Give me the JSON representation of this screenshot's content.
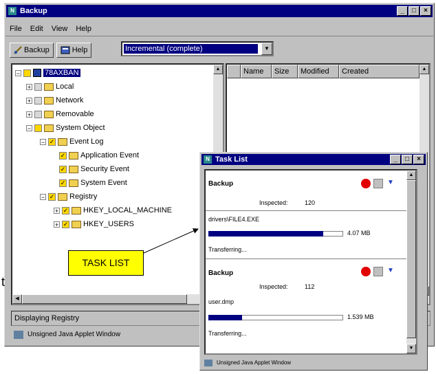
{
  "main_window": {
    "title": "Backup",
    "menu": [
      "File",
      "Edit",
      "View",
      "Help"
    ],
    "toolbar": {
      "backup_label": "Backup",
      "help_label": "Help",
      "mode_value": "Incremental (complete)"
    },
    "tree": [
      {
        "label": "78AXBAN",
        "selected": true
      },
      {
        "label": "Local"
      },
      {
        "label": "Network"
      },
      {
        "label": "Removable"
      },
      {
        "label": "System Object"
      },
      {
        "label": "Event Log"
      },
      {
        "label": "Application Event"
      },
      {
        "label": "Security Event"
      },
      {
        "label": "System Event"
      },
      {
        "label": "Registry"
      },
      {
        "label": "HKEY_LOCAL_MACHINE"
      },
      {
        "label": "HKEY_USERS"
      }
    ],
    "columns": [
      "Name",
      "Size",
      "Modified",
      "Created"
    ],
    "status": "Displaying Registry",
    "applet_notice": "Unsigned Java Applet Window"
  },
  "task_list": {
    "title": "Task List",
    "tasks": [
      {
        "name": "Backup",
        "inspected_label": "Inspected:",
        "inspected_value": "120",
        "file": "drivers\\FILE4.EXE",
        "size": "4.07 MB",
        "progress": 0.85,
        "state": "Transferring..."
      },
      {
        "name": "Backup",
        "inspected_label": "Inspected:",
        "inspected_value": "112",
        "file": "user.dmp",
        "size": "1.539 MB",
        "progress": 0.25,
        "state": "Transferring..."
      }
    ],
    "applet_notice": "Unsigned Java Applet Window"
  },
  "annotation": {
    "label": "TASK LIST",
    "stray_text": "t"
  },
  "colors": {
    "title_bar": "#000080",
    "callout": "#ffff00",
    "progress": "#000080",
    "stop_button": "#e00000"
  }
}
